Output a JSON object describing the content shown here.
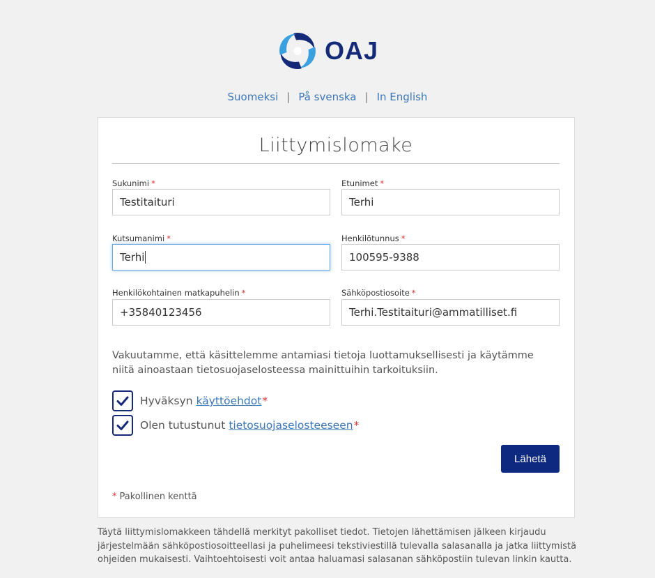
{
  "logo": {
    "text": "OAJ",
    "icon": "oaj-logo-swirl"
  },
  "languages": {
    "finnish": "Suomeksi",
    "separator": "|",
    "swedish": "På svenska",
    "english": "In English"
  },
  "form": {
    "title": "Liittymislomake",
    "required_mark": "*",
    "fields": {
      "surname": {
        "label": "Sukunimi",
        "value": "Testitaituri"
      },
      "first_names": {
        "label": "Etunimet",
        "value": "Terhi"
      },
      "nickname": {
        "label": "Kutsumanimi",
        "value": "Terhi"
      },
      "ssn": {
        "label": "Henkilötunnus",
        "value": "100595-9388"
      },
      "phone": {
        "label": "Henkilökohtainen matkapuhelin",
        "value": "+35840123456"
      },
      "email": {
        "label": "Sähköpostiosoite",
        "value": "Terhi.Testitaituri@ammatilliset.fi"
      }
    },
    "privacy_text": "Vakuutamme, että käsittelemme antamiasi tietoja luottamuksellisesti ja käytämme niitä ainoastaan tietosuojaselosteessa mainittuihin tarkoituksiin.",
    "checkboxes": {
      "terms": {
        "prefix": "Hyväksyn",
        "link": "käyttöehdot",
        "checked": true
      },
      "privacy": {
        "prefix": "Olen tutustunut",
        "link": "tietosuojaselosteeseen",
        "checked": true
      }
    },
    "submit_label": "Lähetä",
    "required_note": "Pakollinen kenttä"
  },
  "footer_text": "Täytä liittymislomakkeen tähdellä merkityt pakolliset tiedot. Tietojen lähettämisen jälkeen kirjaudu järjestelmään sähköpostiosoitteellasi ja puhelimeesi tekstiviestillä tulevalla salasanalla ja jatka liittymistä ohjeiden mukaisesti. Vaihtoehtoisesti voit antaa haluamasi salasanan sähköpostiin tulevan linkin kautta.",
  "colors": {
    "brand_navy": "#142a78",
    "link_blue": "#3a76b8",
    "submit_bg": "#0d2a80",
    "required_red": "#d33",
    "logo_light_blue": "#3aa0e0"
  }
}
